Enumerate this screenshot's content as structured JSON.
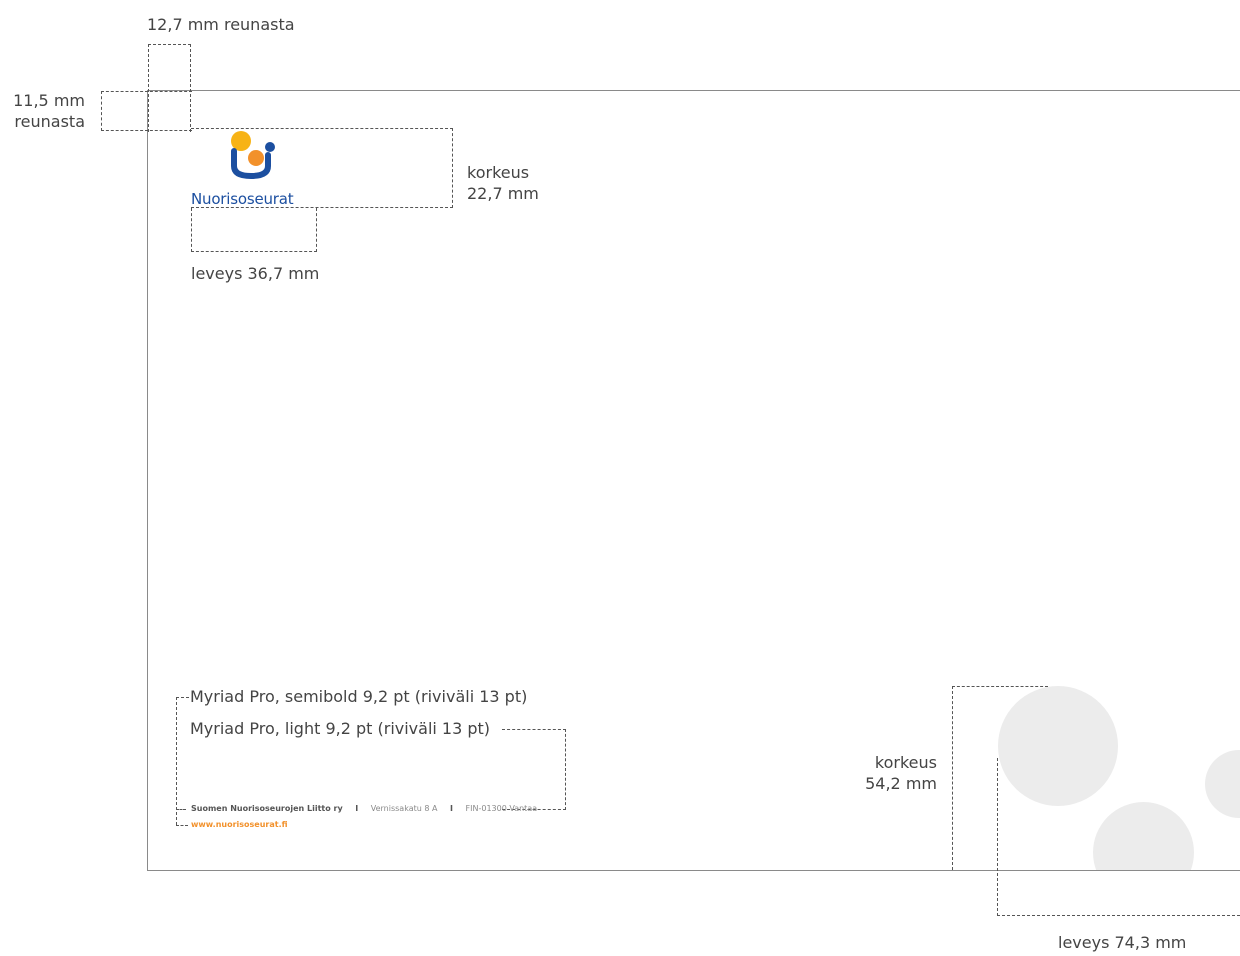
{
  "dimensions": {
    "top_margin": "12,7 mm reunasta",
    "left_margin_value": "11,5 mm",
    "left_margin_unit": "reunasta",
    "logo_height_label": "korkeus",
    "logo_height_value": "22,7 mm",
    "logo_width": "leveys 36,7 mm",
    "decor_height_label": "korkeus",
    "decor_height_value": "54,2 mm",
    "decor_width": "leveys 74,3 mm"
  },
  "typography_notes": {
    "semibold": "Myriad Pro, semibold 9,2 pt (riviväli 13 pt)",
    "light": "Myriad Pro, light 9,2 pt (riviväli 13 pt)"
  },
  "logo": {
    "wordmark": "Nuorisoseurat",
    "colors": {
      "yellow": "#f7b316",
      "orange": "#f2912b",
      "blue": "#1c4fa0"
    }
  },
  "footer": {
    "organization": "Suomen Nuorisoseurojen Liitto ry",
    "separator": "I",
    "street": "Vernissakatu 8 A",
    "city": "FIN-01300 Vantaa",
    "url": "www.nuorisoseurat.fi"
  },
  "colors": {
    "accent": "#f2912b",
    "decor_circles": "#ececec",
    "guide_lines": "#555555"
  }
}
